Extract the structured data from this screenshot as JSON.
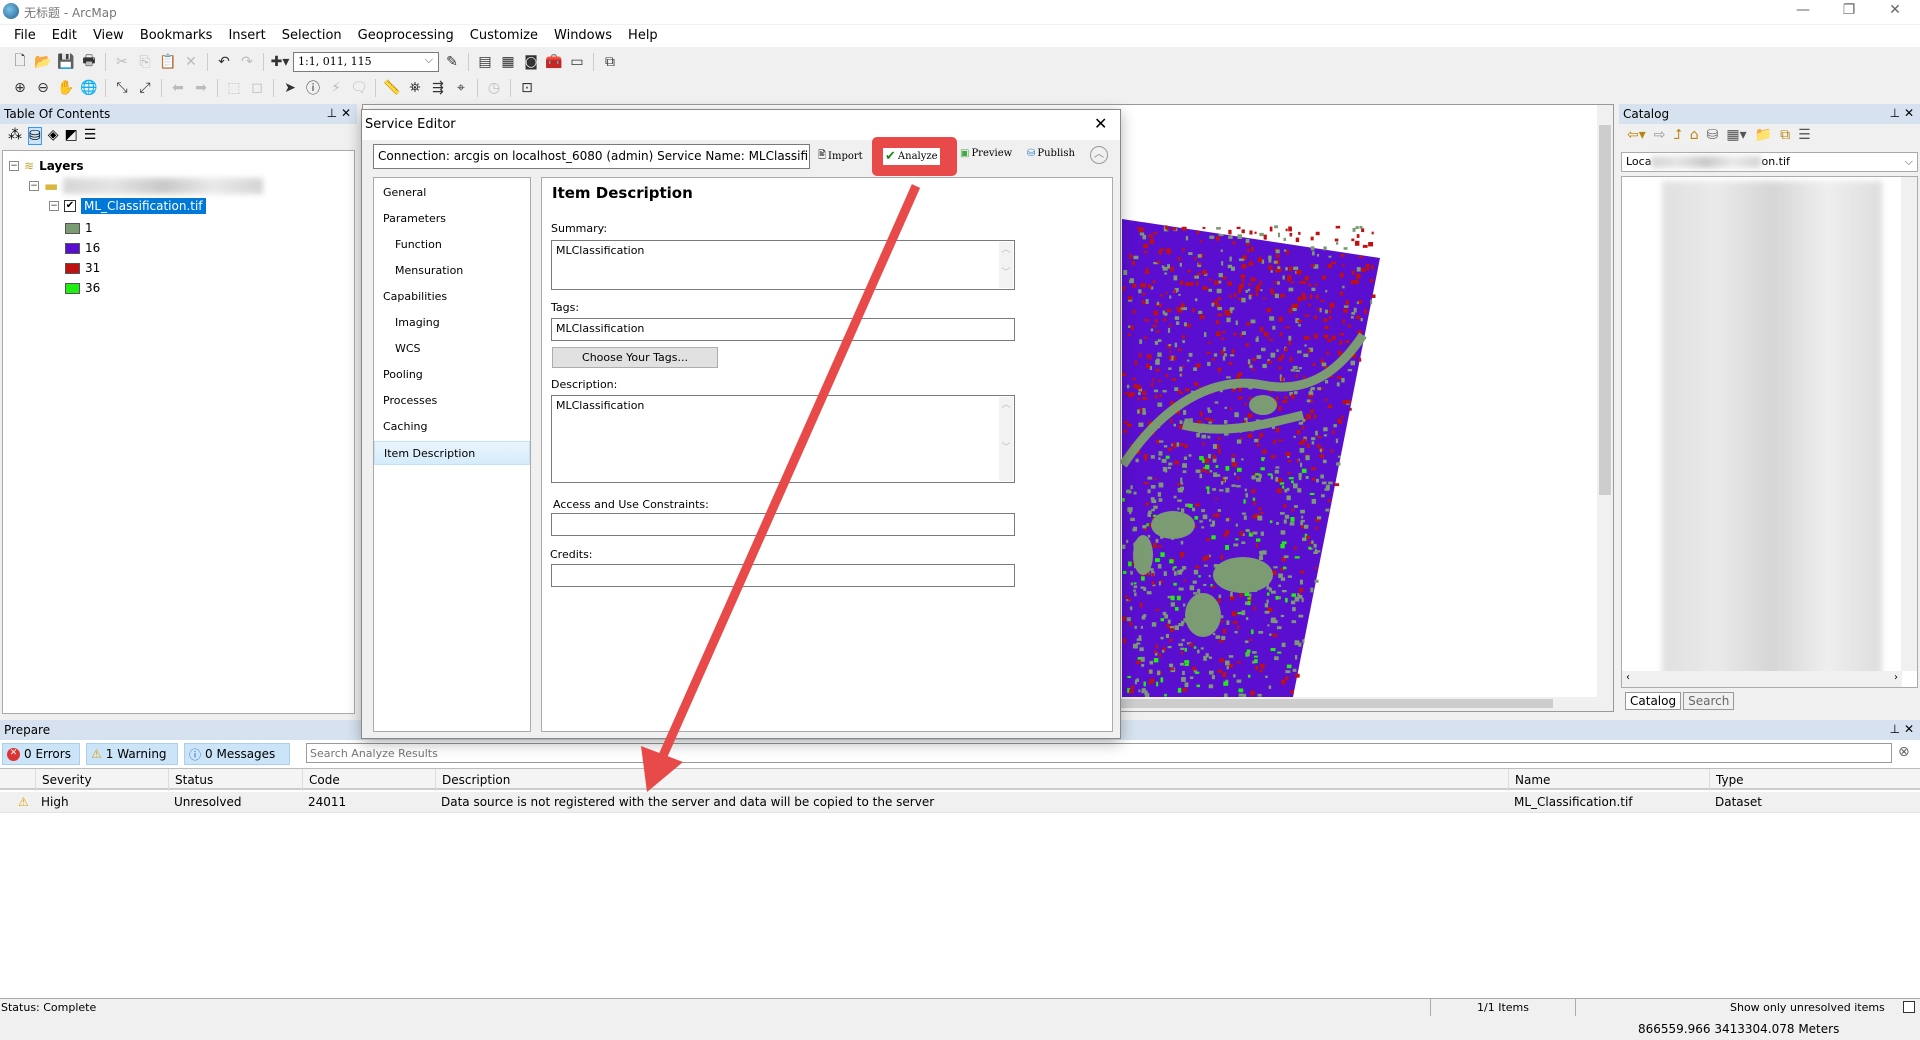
{
  "app": {
    "title": "无标题 - ArcMap"
  },
  "menu": [
    "File",
    "Edit",
    "View",
    "Bookmarks",
    "Insert",
    "Selection",
    "Geoprocessing",
    "Customize",
    "Windows",
    "Help"
  ],
  "toolbar1": {
    "scale": "1:1, 011, 115",
    "icons": [
      {
        "name": "new-document-icon",
        "g": "🗋"
      },
      {
        "name": "open-icon",
        "g": "📂"
      },
      {
        "name": "save-icon",
        "g": "💾"
      },
      {
        "name": "print-icon",
        "g": "🖶"
      },
      {
        "sep": 1
      },
      {
        "name": "cut-icon",
        "g": "✂",
        "dis": 1
      },
      {
        "name": "copy-icon",
        "g": "⎘",
        "dis": 1
      },
      {
        "name": "paste-icon",
        "g": "📋"
      },
      {
        "name": "delete-icon",
        "g": "✕",
        "dis": 1
      },
      {
        "sep": 1
      },
      {
        "name": "undo-icon",
        "g": "↶"
      },
      {
        "name": "redo-icon",
        "g": "↷",
        "dis": 1
      },
      {
        "sep": 1
      },
      {
        "name": "add-data-icon",
        "g": "✚"
      }
    ]
  },
  "toolbar1b": [
    {
      "name": "editor-toolbar-icon",
      "g": "✎"
    },
    {
      "sep": 1
    },
    {
      "name": "toc-window-icon",
      "g": "▤"
    },
    {
      "name": "catalog-window-icon",
      "g": "▦"
    },
    {
      "name": "search-window-icon",
      "g": "◙"
    },
    {
      "name": "arctoolbox-icon",
      "g": "🧰"
    },
    {
      "name": "python-window-icon",
      "g": "▭"
    },
    {
      "sep": 1
    },
    {
      "name": "model-builder-icon",
      "g": "⧉"
    }
  ],
  "toolbar2": [
    {
      "name": "zoom-in-icon",
      "g": "⊕"
    },
    {
      "name": "zoom-out-icon",
      "g": "⊖"
    },
    {
      "name": "pan-icon",
      "g": "✋"
    },
    {
      "name": "full-extent-icon",
      "g": "🌐"
    },
    {
      "sep": 1
    },
    {
      "name": "fixed-zoom-in-icon",
      "g": "⤡"
    },
    {
      "name": "fixed-zoom-out-icon",
      "g": "⤢"
    },
    {
      "sep": 1
    },
    {
      "name": "back-extent-icon",
      "g": "⬅",
      "dis": 1
    },
    {
      "name": "forward-extent-icon",
      "g": "➡",
      "dis": 1
    },
    {
      "sep": 1
    },
    {
      "name": "select-features-icon",
      "g": "⬚",
      "dis": 1
    },
    {
      "name": "clear-selection-icon",
      "g": "◻",
      "dis": 1
    },
    {
      "sep": 1
    },
    {
      "name": "select-elements-icon",
      "g": "➤"
    },
    {
      "name": "identify-icon",
      "g": "ⓘ"
    },
    {
      "name": "hyperlink-icon",
      "g": "⚡",
      "dis": 1
    },
    {
      "name": "html-popup-icon",
      "g": "🗨",
      "dis": 1
    },
    {
      "sep": 1
    },
    {
      "name": "measure-icon",
      "g": "📏"
    },
    {
      "name": "find-icon",
      "g": "⛯"
    },
    {
      "name": "find-route-icon",
      "g": "⇶"
    },
    {
      "name": "go-to-xy-icon",
      "g": "⌖"
    },
    {
      "sep": 1
    },
    {
      "name": "time-slider-icon",
      "g": "◷",
      "dis": 1
    },
    {
      "sep": 1
    },
    {
      "name": "create-viewer-icon",
      "g": "⊡"
    }
  ],
  "toc": {
    "title": "Table Of Contents",
    "root": "Layers",
    "layer": "ML_Classification.tif",
    "legend": [
      {
        "label": "1",
        "color": "#7b9b73"
      },
      {
        "label": "16",
        "color": "#5a0fd0"
      },
      {
        "label": "31",
        "color": "#c01010"
      },
      {
        "label": "36",
        "color": "#20ee10"
      }
    ]
  },
  "catalog": {
    "title": "Catalog",
    "location_prefix": "Loca",
    "location_suffix": "on.tif",
    "tabs": [
      "Catalog",
      "Search"
    ]
  },
  "dialog": {
    "title": "Service Editor",
    "connection": "Connection: arcgis on localhost_6080 (admin)    Service Name: MLClassifi...",
    "buttons": {
      "import": "Import",
      "analyze": "Analyze",
      "preview": "Preview",
      "publish": "Publish"
    },
    "nav": [
      {
        "label": "General"
      },
      {
        "label": "Parameters"
      },
      {
        "label": "Function",
        "sub": true
      },
      {
        "label": "Mensuration",
        "sub": true
      },
      {
        "label": "Capabilities"
      },
      {
        "label": "Imaging",
        "sub": true
      },
      {
        "label": "WCS",
        "sub": true
      },
      {
        "label": "Pooling"
      },
      {
        "label": "Processes"
      },
      {
        "label": "Caching"
      },
      {
        "label": "Item Description",
        "selected": true
      }
    ],
    "content": {
      "heading": "Item Description",
      "summary_label": "Summary:",
      "summary": "MLClassification",
      "tags_label": "Tags:",
      "tags": "MLClassification",
      "choose_tags": "Choose Your Tags...",
      "description_label": "Description:",
      "description": "MLClassification",
      "access_label": "Access and Use Constraints:",
      "access": "",
      "credits_label": "Credits:",
      "credits": ""
    }
  },
  "prepare": {
    "title": "Prepare",
    "errors": "0 Errors",
    "warnings": "1 Warning",
    "messages": "0 Messages",
    "search_placeholder": "Search Analyze Results",
    "columns": [
      "Severity",
      "Status",
      "Code",
      "Description",
      "Name",
      "Type"
    ],
    "rows": [
      {
        "severity": "High",
        "status": "Unresolved",
        "code": "24011",
        "description": "Data source is not registered with the server and data will be copied to the server",
        "name": "ML_Classification.tif",
        "type": "Dataset"
      }
    ]
  },
  "status": {
    "text": "Status: Complete",
    "items": "1/1 Items",
    "unresolved_label": "Show only unresolved items",
    "unresolved_checked": false
  },
  "coords": "866559.966  3413304.078 Meters",
  "colors": {
    "highlight": "#e84a4a",
    "selection": "#0078d7",
    "raster_purple": "#5a0fd0"
  }
}
